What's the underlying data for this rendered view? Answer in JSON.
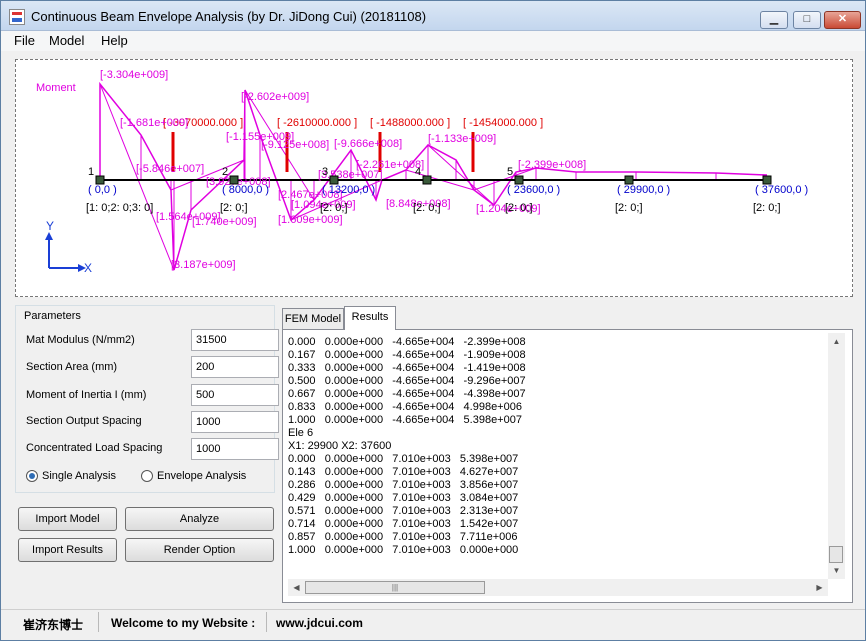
{
  "window": {
    "title": "Continuous Beam Envelope Analysis (by Dr. JiDong Cui) (20181108)"
  },
  "titlebar_buttons": {
    "minimize": "▁",
    "maximize": "□",
    "close": "✕"
  },
  "menu": [
    "File",
    "Model",
    "Help"
  ],
  "plot": {
    "moment_label": "Moment",
    "axis_x": "X",
    "axis_y": "Y",
    "nodes": [
      {
        "num": "1",
        "coord": "( 0,0 )",
        "bc": "[1: 0;2: 0;3: 0]"
      },
      {
        "num": "2",
        "coord": "( 8000,0 )",
        "bc": "[2: 0;]"
      },
      {
        "num": "3",
        "coord": "( 13200,0 )",
        "bc": "[2: 0;]"
      },
      {
        "num": "4",
        "coord": "",
        "bc": "[2: 0;]"
      },
      {
        "num": "5",
        "coord": "( 23600,0 )",
        "bc": "[2: 0;]"
      },
      {
        "num": "",
        "coord": "( 29900,0 )",
        "bc": "[2: 0;]"
      },
      {
        "num": "",
        "coord": "( 37600,0 )",
        "bc": "[2: 0;]"
      }
    ],
    "loads": [
      "[ -3070000.000 ]",
      "[ -2610000.000 ]",
      "[ -1488000.000 ]",
      "[ -1454000.000 ]"
    ],
    "moment_labels": [
      "[-3.304e+009]",
      "[-1.681e+009]",
      "[-5.846e+007]",
      "[1.564e+009]",
      "[3.187e+009]",
      "[1.740e+009]",
      "[-2.602e+009]",
      "[-1.155e+009]",
      "[-9.125e+008]",
      "[3.927e+008]",
      "[2.467e+008]",
      "[1.609e+009]",
      "[1.094e+009]",
      "[-9.666e+008]",
      "[3.538e+007]",
      "[-2.261e+008]",
      "[-1.133e+009]",
      "[8.848e+008]",
      "[1.204e+009]",
      "[-2.399e+008]"
    ]
  },
  "params": {
    "title": "Parameters",
    "fields": [
      {
        "label": "Mat Modulus (N/mm2)",
        "value": "31500"
      },
      {
        "label": "Section Area  (mm)",
        "value": "200"
      },
      {
        "label": "Moment of Inertia I (mm)",
        "value": "500"
      },
      {
        "label": "Section Output Spacing",
        "value": "1000"
      },
      {
        "label": "Concentrated Load Spacing",
        "value": "1000"
      }
    ],
    "radio_single": "Single Analysis",
    "radio_envelope": "Envelope Analysis"
  },
  "buttons": {
    "import_model": "Import Model",
    "analyze": "Analyze",
    "import_results": "Import Results",
    "render_option": "Render Option"
  },
  "tabs": {
    "fem": "FEM Model",
    "results": "Results"
  },
  "results_lines": [
    "0.000   0.000e+000   -4.665e+004   -2.399e+008",
    "0.167   0.000e+000   -4.665e+004   -1.909e+008",
    "0.333   0.000e+000   -4.665e+004   -1.419e+008",
    "0.500   0.000e+000   -4.665e+004   -9.296e+007",
    "0.667   0.000e+000   -4.665e+004   -4.398e+007",
    "0.833   0.000e+000   -4.665e+004   4.998e+006",
    "1.000   0.000e+000   -4.665e+004   5.398e+007",
    "Ele 6",
    "X1: 29900 X2: 37600",
    "0.000   0.000e+000   7.010e+003   5.398e+007",
    "0.143   0.000e+000   7.010e+003   4.627e+007",
    "0.286   0.000e+000   7.010e+003   3.856e+007",
    "0.429   0.000e+000   7.010e+003   3.084e+007",
    "0.571   0.000e+000   7.010e+003   2.313e+007",
    "0.714   0.000e+000   7.010e+003   1.542e+007",
    "0.857   0.000e+000   7.010e+003   7.711e+006",
    "1.000   0.000e+000   7.010e+003   0.000e+000"
  ],
  "status": {
    "author": "崔济东博士",
    "welcome": "Welcome to my Website :",
    "url": "www.jdcui.com"
  },
  "colors": {
    "moment": "#e000e0",
    "load": "#e00000",
    "node_text": "#0000cc",
    "axis": "#1a3fd6"
  }
}
